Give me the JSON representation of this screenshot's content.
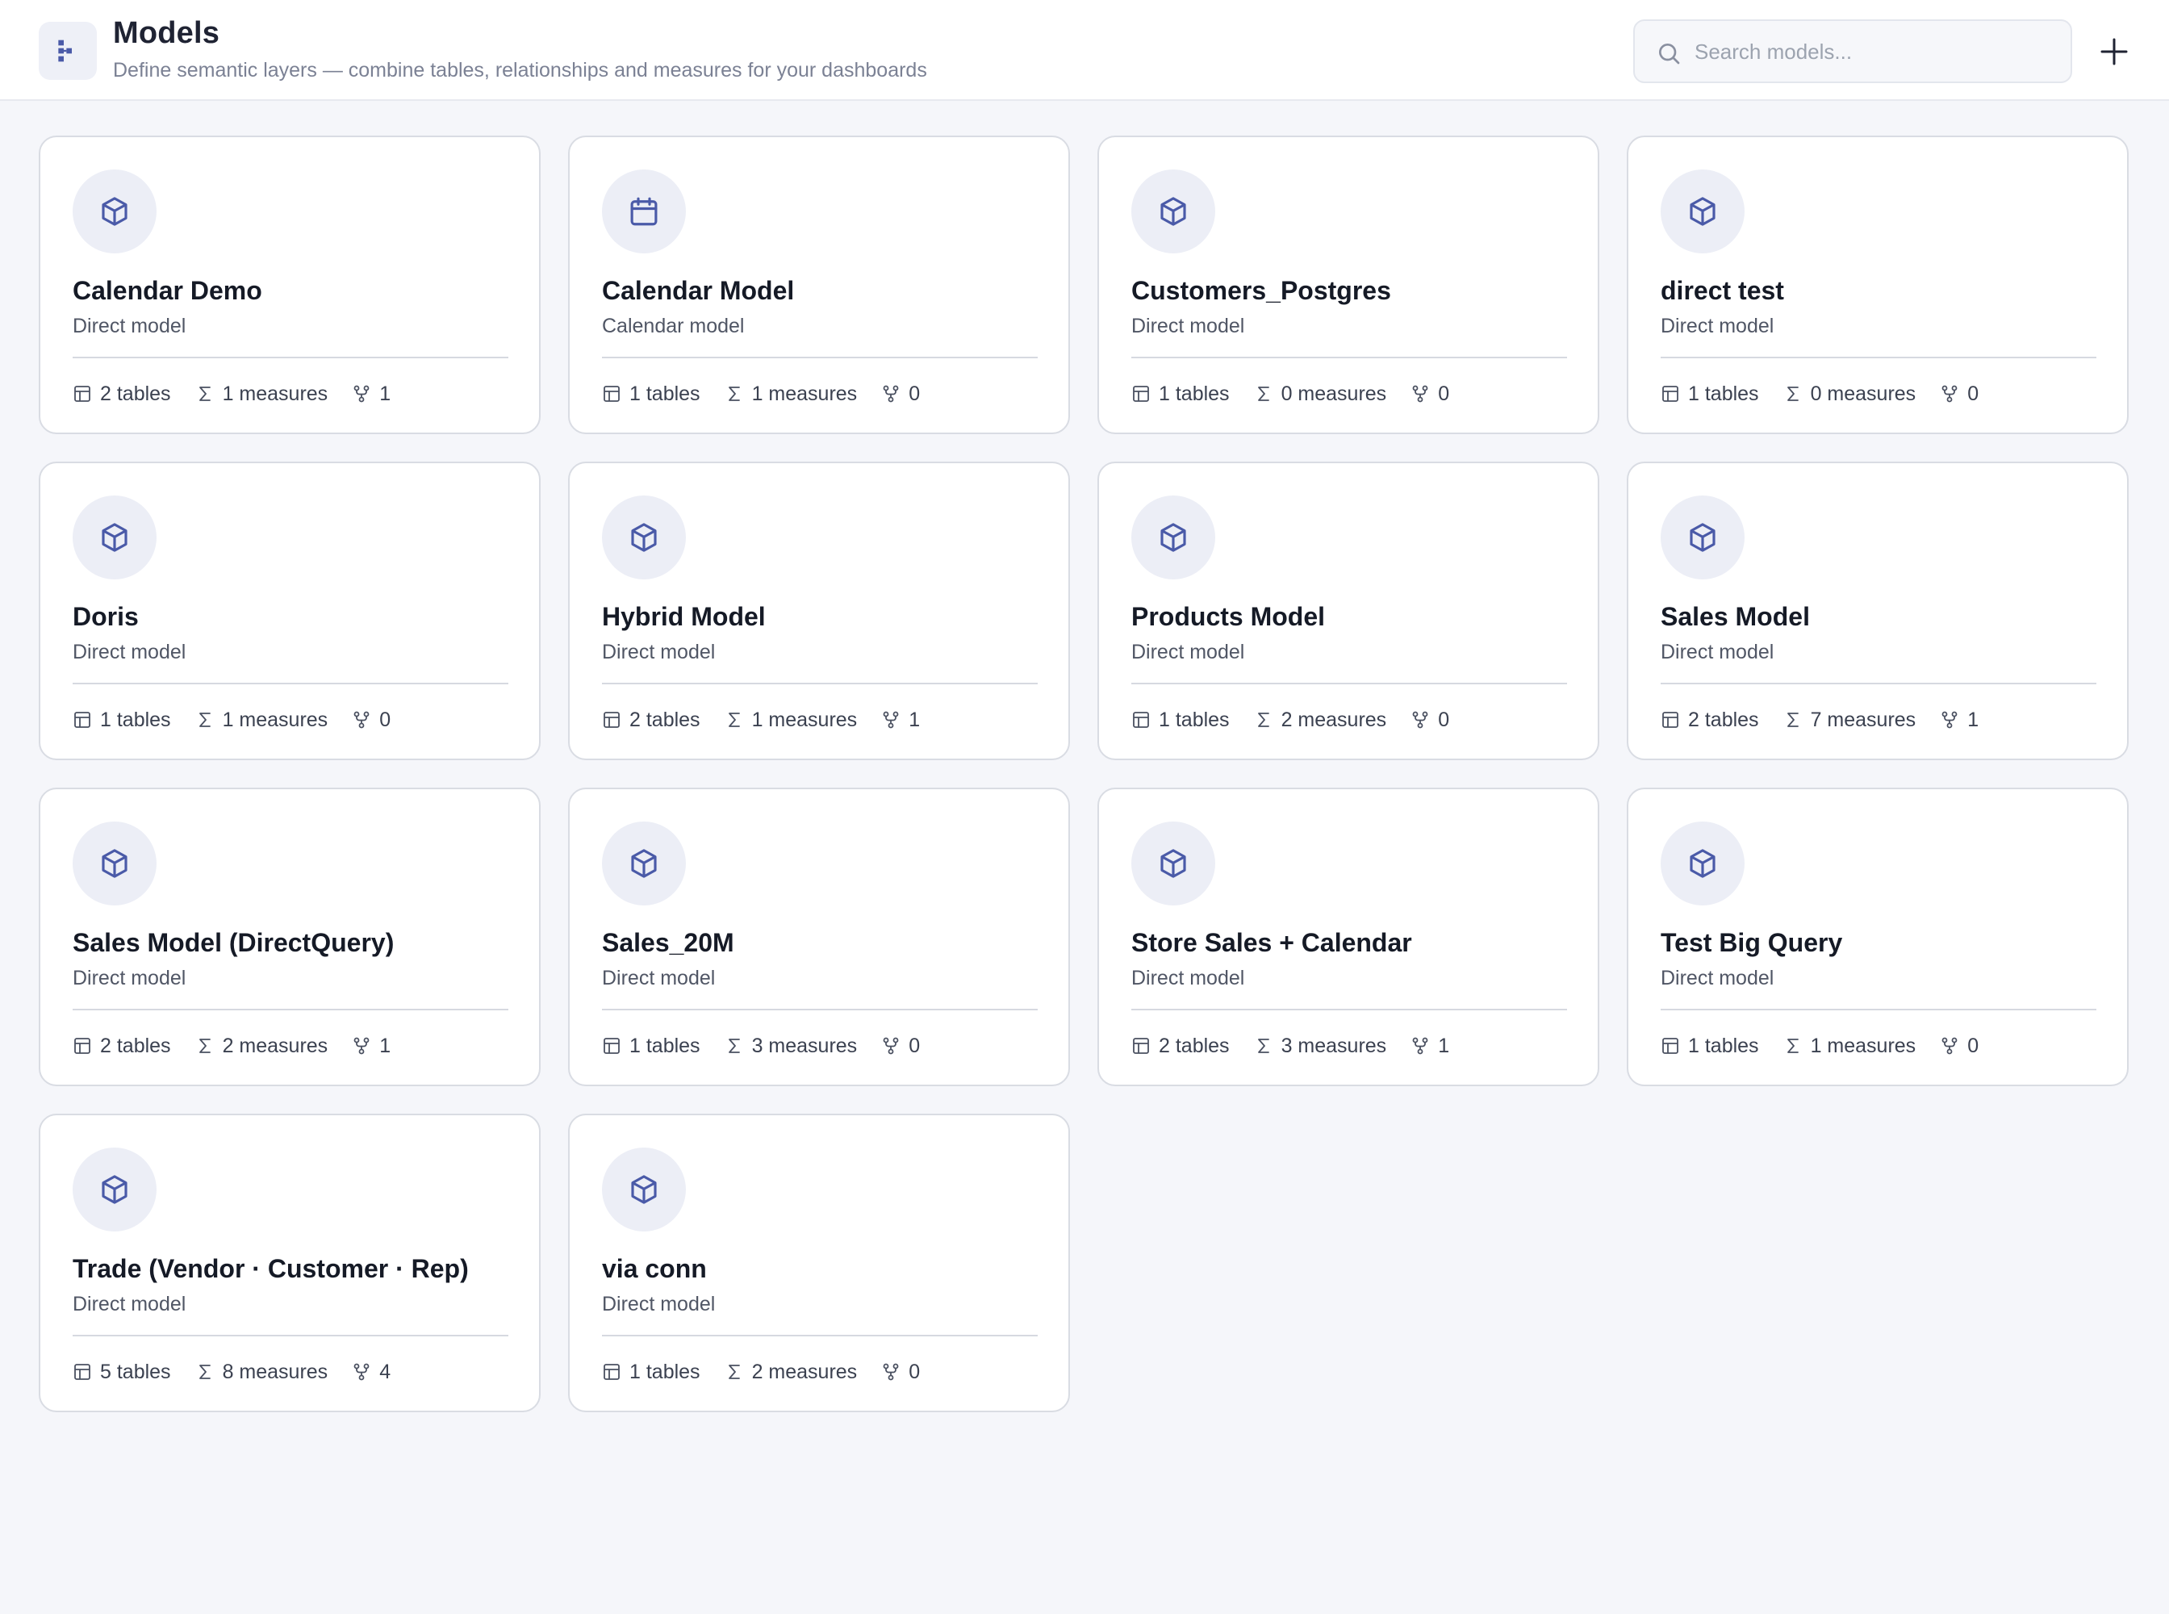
{
  "header": {
    "title": "Models",
    "subtitle": "Define semantic layers — combine tables, relationships and measures for your dashboards",
    "app_icon": "model-hierarchy-icon",
    "search_placeholder": "Search models...",
    "search_value": "",
    "add_icon": "plus-icon"
  },
  "colors": {
    "accent": "#4a5aa8",
    "icon_bg": "#eceef6",
    "page_bg": "#f5f6fa"
  },
  "models": [
    {
      "name": "Calendar Demo",
      "type": "Direct model",
      "icon": "cube-icon",
      "tables": "2 tables",
      "measures": "1 measures",
      "relationships": "1"
    },
    {
      "name": "Calendar Model",
      "type": "Calendar model",
      "icon": "calendar-icon",
      "tables": "1 tables",
      "measures": "1 measures",
      "relationships": "0"
    },
    {
      "name": "Customers_Postgres",
      "type": "Direct model",
      "icon": "cube-icon",
      "tables": "1 tables",
      "measures": "0 measures",
      "relationships": "0"
    },
    {
      "name": "direct test",
      "type": "Direct model",
      "icon": "cube-icon",
      "tables": "1 tables",
      "measures": "0 measures",
      "relationships": "0"
    },
    {
      "name": "Doris",
      "type": "Direct model",
      "icon": "cube-icon",
      "tables": "1 tables",
      "measures": "1 measures",
      "relationships": "0"
    },
    {
      "name": "Hybrid Model",
      "type": "Direct model",
      "icon": "cube-icon",
      "tables": "2 tables",
      "measures": "1 measures",
      "relationships": "1"
    },
    {
      "name": "Products Model",
      "type": "Direct model",
      "icon": "cube-icon",
      "tables": "1 tables",
      "measures": "2 measures",
      "relationships": "0"
    },
    {
      "name": "Sales Model",
      "type": "Direct model",
      "icon": "cube-icon",
      "tables": "2 tables",
      "measures": "7 measures",
      "relationships": "1"
    },
    {
      "name": "Sales Model (DirectQuery)",
      "type": "Direct model",
      "icon": "cube-icon",
      "tables": "2 tables",
      "measures": "2 measures",
      "relationships": "1"
    },
    {
      "name": "Sales_20M",
      "type": "Direct model",
      "icon": "cube-icon",
      "tables": "1 tables",
      "measures": "3 measures",
      "relationships": "0"
    },
    {
      "name": "Store Sales + Calendar",
      "type": "Direct model",
      "icon": "cube-icon",
      "tables": "2 tables",
      "measures": "3 measures",
      "relationships": "1"
    },
    {
      "name": "Test Big Query",
      "type": "Direct model",
      "icon": "cube-icon",
      "tables": "1 tables",
      "measures": "1 measures",
      "relationships": "0"
    },
    {
      "name": "Trade (Vendor · Customer · Rep)",
      "type": "Direct model",
      "icon": "cube-icon",
      "tables": "5 tables",
      "measures": "8 measures",
      "relationships": "4"
    },
    {
      "name": "via conn",
      "type": "Direct model",
      "icon": "cube-icon",
      "tables": "1 tables",
      "measures": "2 measures",
      "relationships": "0"
    }
  ]
}
